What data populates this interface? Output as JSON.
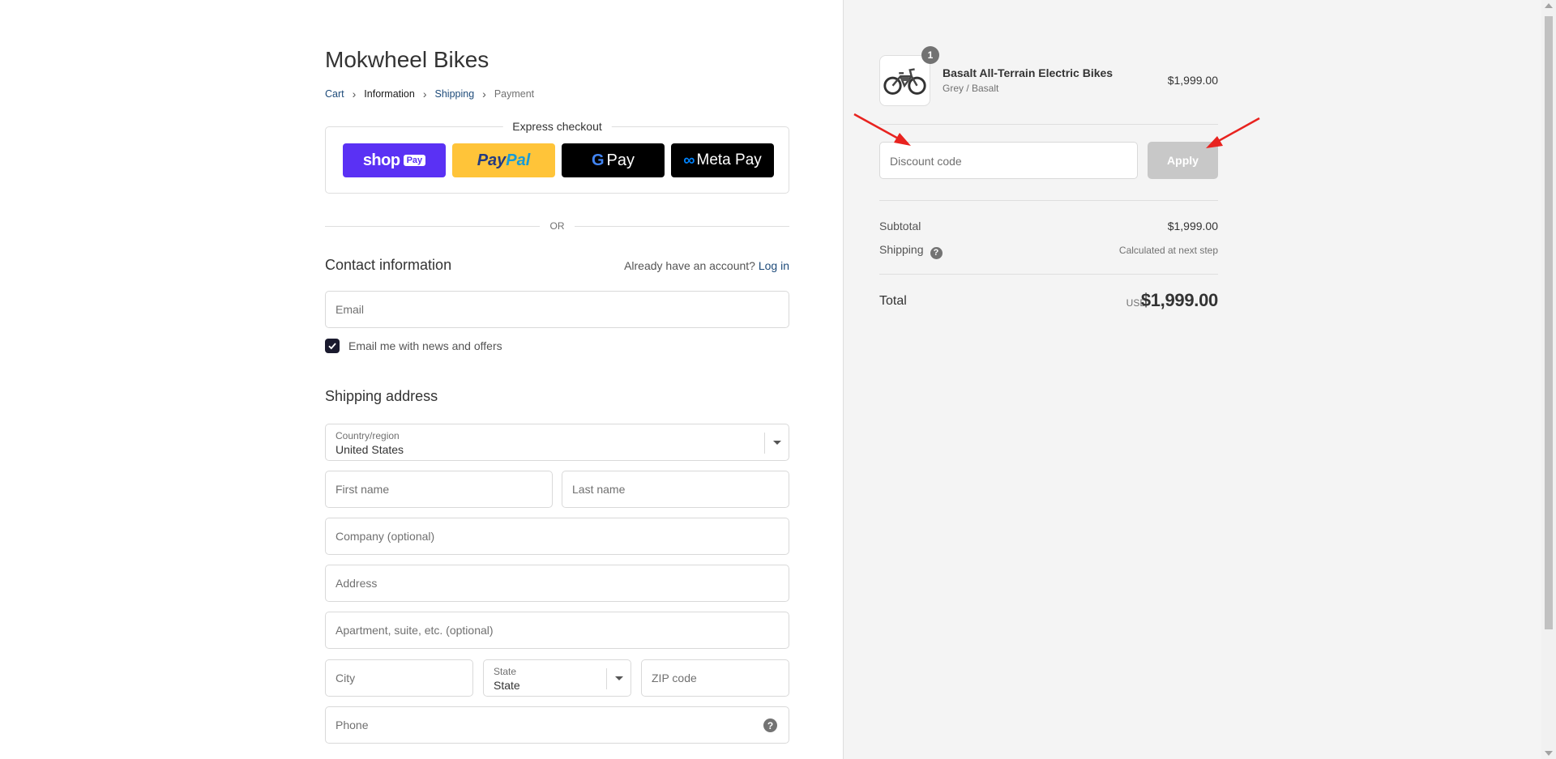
{
  "store": {
    "title": "Mokwheel Bikes"
  },
  "breadcrumb": [
    {
      "label": "Cart"
    },
    {
      "label": "Information"
    },
    {
      "label": "Shipping"
    },
    {
      "label": "Payment"
    }
  ],
  "express": {
    "label": "Express checkout",
    "shop_pay": {
      "word": "shop",
      "tag": "Pay"
    },
    "paypal": {
      "part1": "Pay",
      "part2": "Pal"
    },
    "gpay": {
      "g": "G",
      "label": "Pay"
    },
    "metapay": {
      "logo": "∞",
      "label": "Meta Pay"
    }
  },
  "or_text": "OR",
  "contact": {
    "title": "Contact information",
    "account_prompt": "Already have an account?",
    "login_link": "Log in",
    "email_placeholder": "Email",
    "newsletter_label": "Email me with news and offers",
    "newsletter_checked": true
  },
  "shipping": {
    "title": "Shipping address",
    "country_label": "Country/region",
    "country_value": "United States",
    "first_name_placeholder": "First name",
    "last_name_placeholder": "Last name",
    "company_placeholder": "Company (optional)",
    "address_placeholder": "Address",
    "apartment_placeholder": "Apartment, suite, etc. (optional)",
    "city_placeholder": "City",
    "state_label": "State",
    "state_value": "State",
    "zip_placeholder": "ZIP code",
    "phone_placeholder": "Phone",
    "phone_help_icon": "?"
  },
  "summary": {
    "quantity": "1",
    "product_name": "Basalt All-Terrain Electric Bikes",
    "product_variant": "Grey / Basalt",
    "product_price": "$1,999.00",
    "discount_placeholder": "Discount code",
    "apply_label": "Apply",
    "subtotal_label": "Subtotal",
    "subtotal_value": "$1,999.00",
    "shipping_label": "Shipping",
    "shipping_help_icon": "?",
    "shipping_value": "Calculated at next step",
    "total_label": "Total",
    "currency": "USD",
    "total_value": "$1,999.00"
  },
  "colors": {
    "shop_pay": "#5a31f4",
    "paypal": "#ffc439",
    "annotation_arrow": "#e8231f",
    "apply_disabled": "#c8c8c8"
  }
}
